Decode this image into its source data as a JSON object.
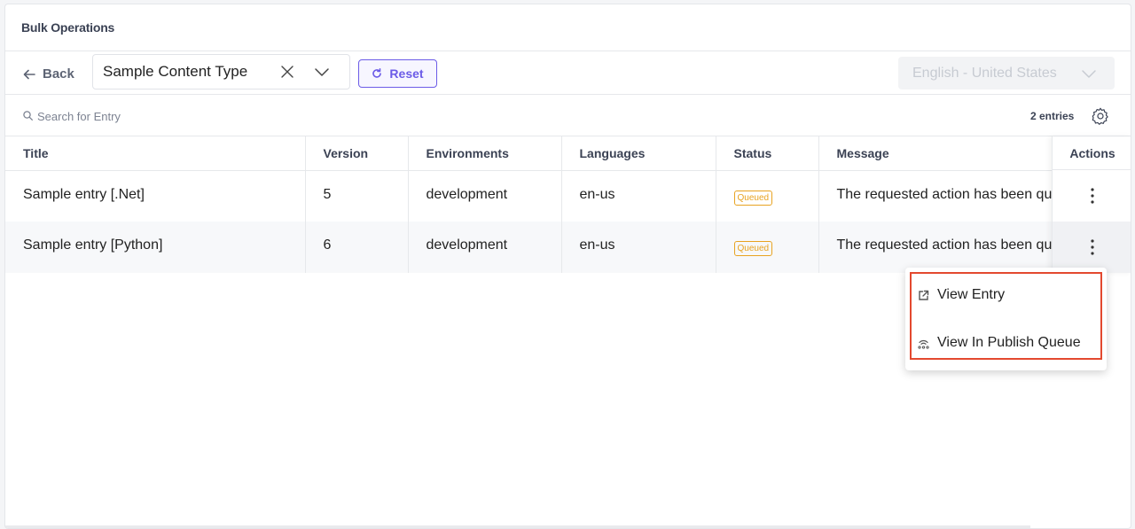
{
  "header": {
    "title": "Bulk Operations"
  },
  "toolbar": {
    "back_label": "Back",
    "content_type": "Sample Content Type",
    "reset_label": "Reset",
    "language": "English - United States"
  },
  "search": {
    "placeholder": "Search for Entry",
    "entries_count": "2 entries"
  },
  "table": {
    "columns": [
      "Title",
      "Version",
      "Environments",
      "Languages",
      "Status",
      "Message",
      "Actions"
    ],
    "rows": [
      {
        "title": "Sample entry [.Net]",
        "version": "5",
        "environment": "development",
        "language": "en-us",
        "status": "Queued",
        "message": "The requested action has been queued"
      },
      {
        "title": "Sample entry [Python]",
        "version": "6",
        "environment": "development",
        "language": "en-us",
        "status": "Queued",
        "message": "The requested action has been queued"
      }
    ]
  },
  "menu": {
    "items": [
      "View Entry",
      "View In Publish Queue"
    ]
  },
  "colors": {
    "accent": "#6c5ce7",
    "status_queued": "#e8a321",
    "highlight": "#e3492f"
  }
}
